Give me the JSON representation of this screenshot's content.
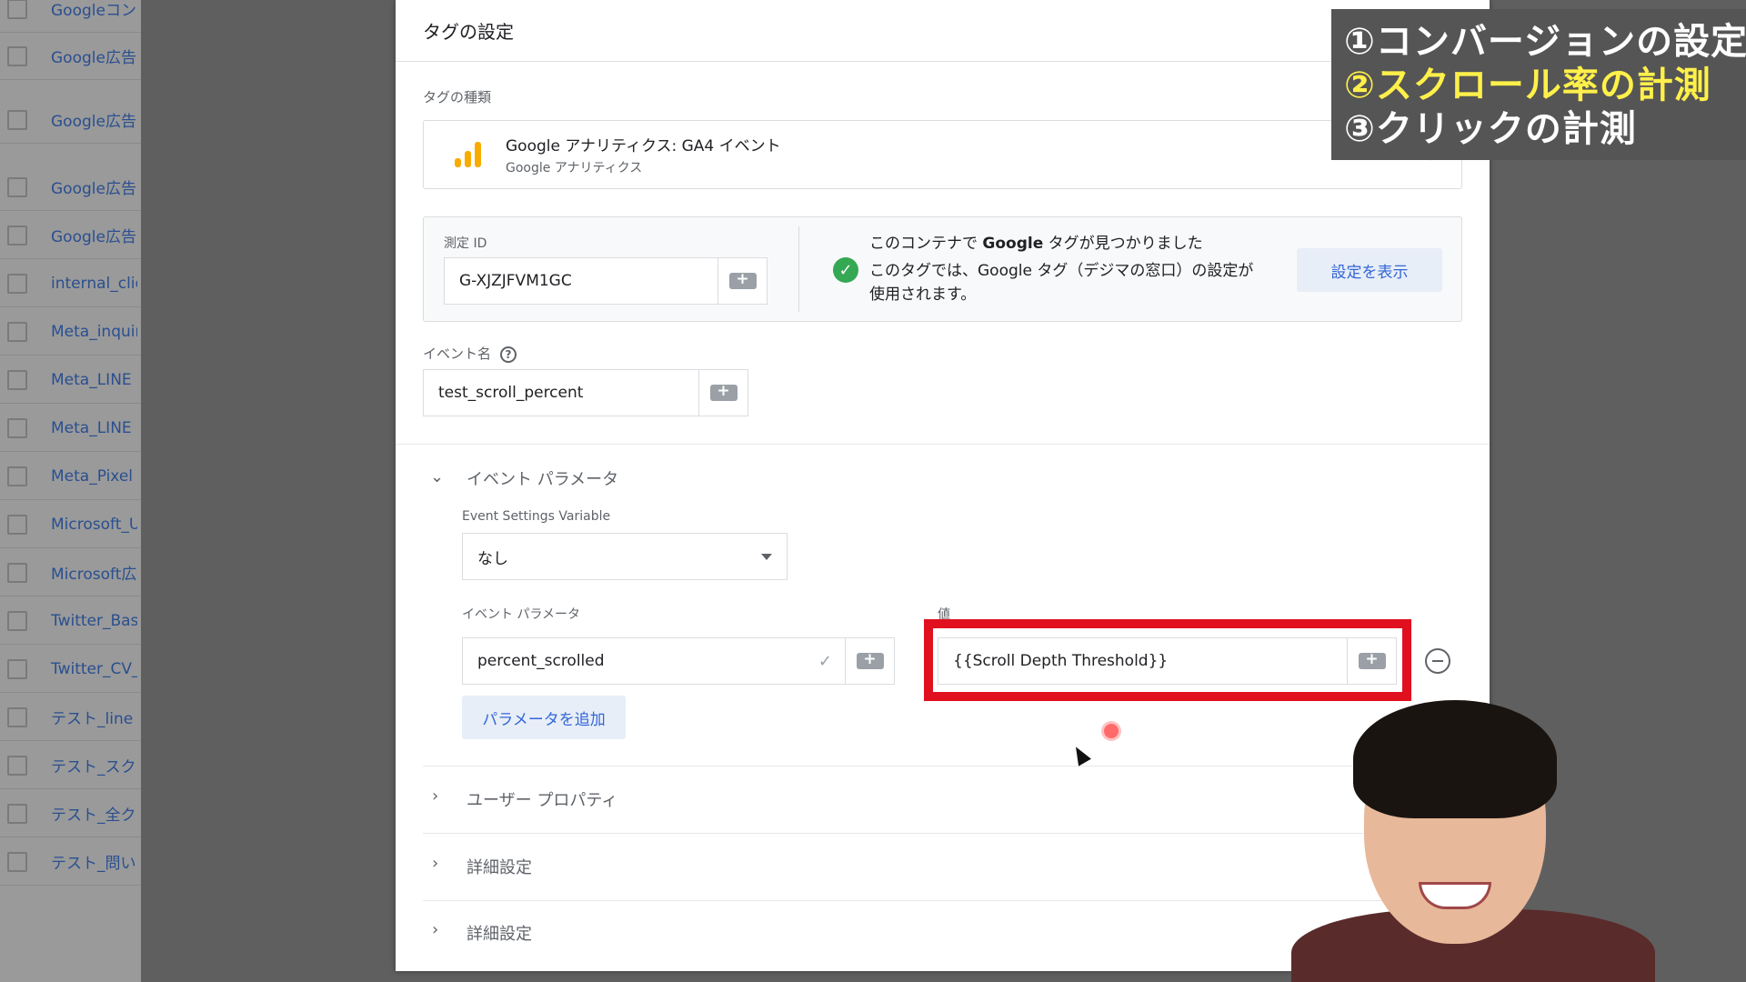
{
  "left_list": {
    "items": [
      "Googleコン",
      "Google広告",
      "Google広告",
      "Google広告",
      "Google広告",
      "internal_clic",
      "Meta_inquir",
      "Meta_LINE",
      "Meta_LINE",
      "Meta_Pixel",
      "Microsoft_U",
      "Microsoft広",
      "Twitter_Bas",
      "Twitter_CV_",
      "テスト_line",
      "テスト_スク",
      "テスト_全ク",
      "テスト_問い"
    ]
  },
  "panel": {
    "header": "タグの設定",
    "tag_type_label": "タグの種類",
    "tag_type_title": "Google アナリティクス: GA4 イベント",
    "tag_type_sub": "Google アナリティクス",
    "measurement_label": "測定 ID",
    "measurement_value": "G-XJZJFVM1GC",
    "notice_line1_a": "このコンテナで ",
    "notice_line1_b": "Google",
    "notice_line1_c": " タグが見つかりました",
    "notice_line2": "このタグでは、Google タグ（デジマの窓口）の設定が",
    "notice_line3": "使用されます。",
    "show_settings": "設定を表示",
    "event_name_label": "イベント名",
    "event_name_value": "test_scroll_percent",
    "event_params_section": "イベント パラメータ",
    "event_settings_variable_label": "Event Settings Variable",
    "event_settings_variable_value": "なし",
    "param_col_label": "イベント パラメータ",
    "value_col_label": "値",
    "param_name": "percent_scrolled",
    "param_value": "{{Scroll Depth Threshold}}",
    "add_param": "パラメータを追加",
    "user_properties": "ユーザー プロパティ",
    "advanced_1": "詳細設定",
    "advanced_2": "詳細設定"
  },
  "overlay": {
    "items": [
      "①コンバージョンの設定",
      "②スクロール率の計測",
      "③クリックの計測"
    ],
    "active_index": 1,
    "active_color": "#fff04a"
  },
  "colors": {
    "highlight": "#e0101f",
    "link": "#3367d6",
    "success": "#34a853",
    "ga_icon": "#f9ab00"
  }
}
